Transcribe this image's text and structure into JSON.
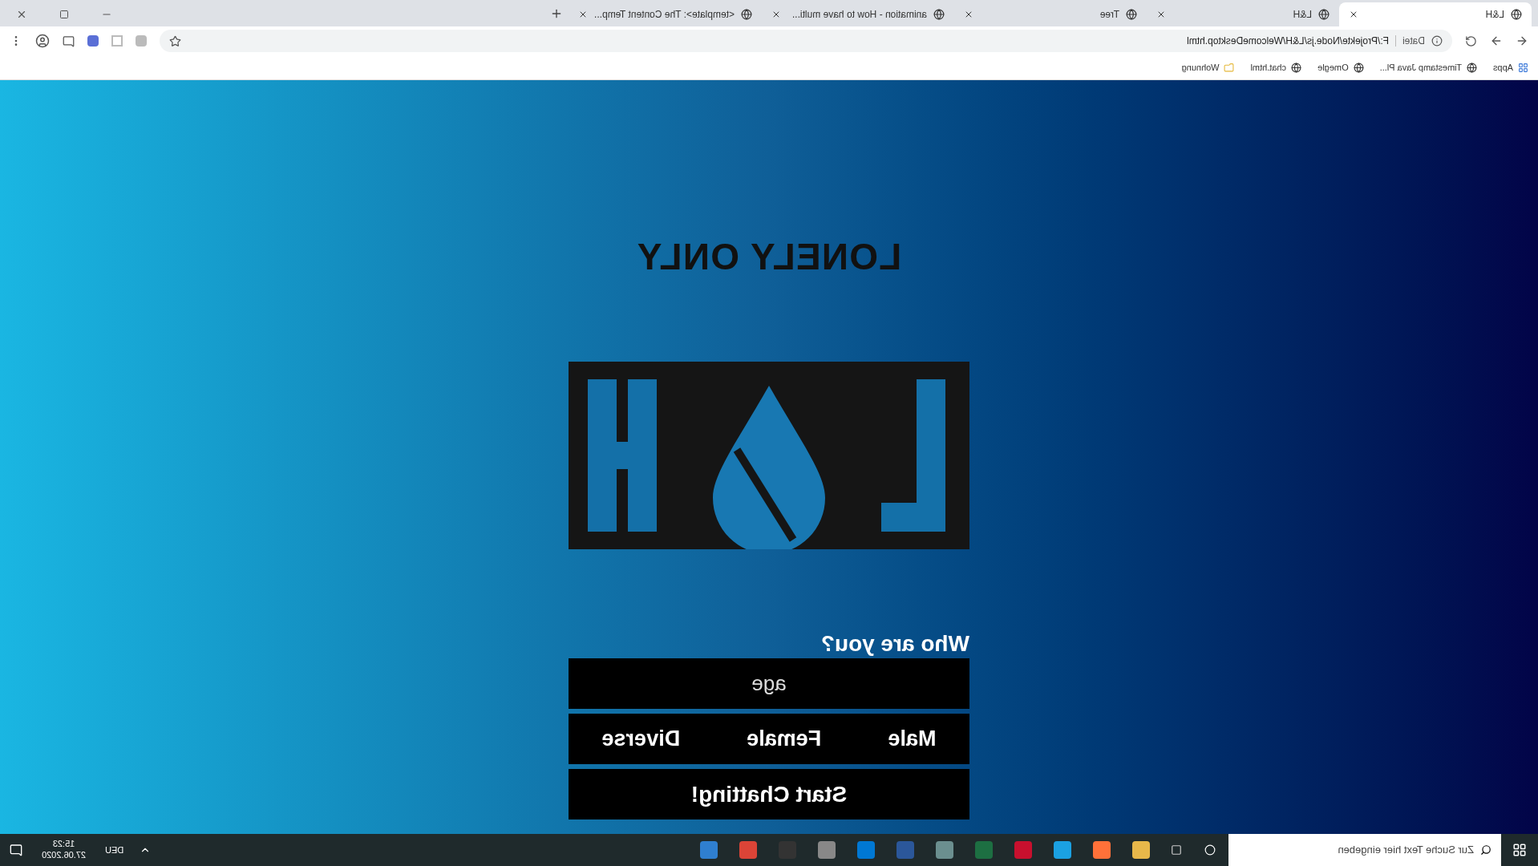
{
  "browser": {
    "tabs": [
      {
        "title": "<template>: The Content Temp...",
        "selected": false
      },
      {
        "title": "animation - How to have multi...",
        "selected": false
      },
      {
        "title": "Tree",
        "selected": false
      },
      {
        "title": "L&H",
        "selected": false
      },
      {
        "title": "L&H",
        "selected": true
      }
    ],
    "address": {
      "url": "F:/Projekte/Node.js/L&H/WelcomeDesktop.html",
      "scheme": "Datei"
    },
    "bookmarks": [
      "Wohnung",
      "chat.html",
      "Omegle",
      "Timestamp Java Pl...",
      "Apps"
    ]
  },
  "page": {
    "title": "LONELY ONLY",
    "form": {
      "label": "Who are you?",
      "age": {
        "placeholder": "age"
      },
      "genders": [
        "Diverse",
        "Female",
        "Male"
      ],
      "submit": "Start Chatting!"
    }
  },
  "taskbar": {
    "search": {
      "placeholder": "Zur Suche Text hier eingeben"
    },
    "apps": [
      {
        "color": "#2f7fd0"
      },
      {
        "color": "#db4437"
      },
      {
        "color": "#333333"
      },
      {
        "color": "#888888"
      },
      {
        "color": "#0078d4"
      },
      {
        "color": "#2b579a"
      },
      {
        "color": "#6b8f8f"
      },
      {
        "color": "#1d6f42"
      },
      {
        "color": "#c8102e"
      },
      {
        "color": "#1ba1e2"
      },
      {
        "color": "#ff7139"
      },
      {
        "color": "#e8b84a"
      }
    ],
    "language": "DEU",
    "time": "15:23",
    "date": "27.06.2020"
  }
}
